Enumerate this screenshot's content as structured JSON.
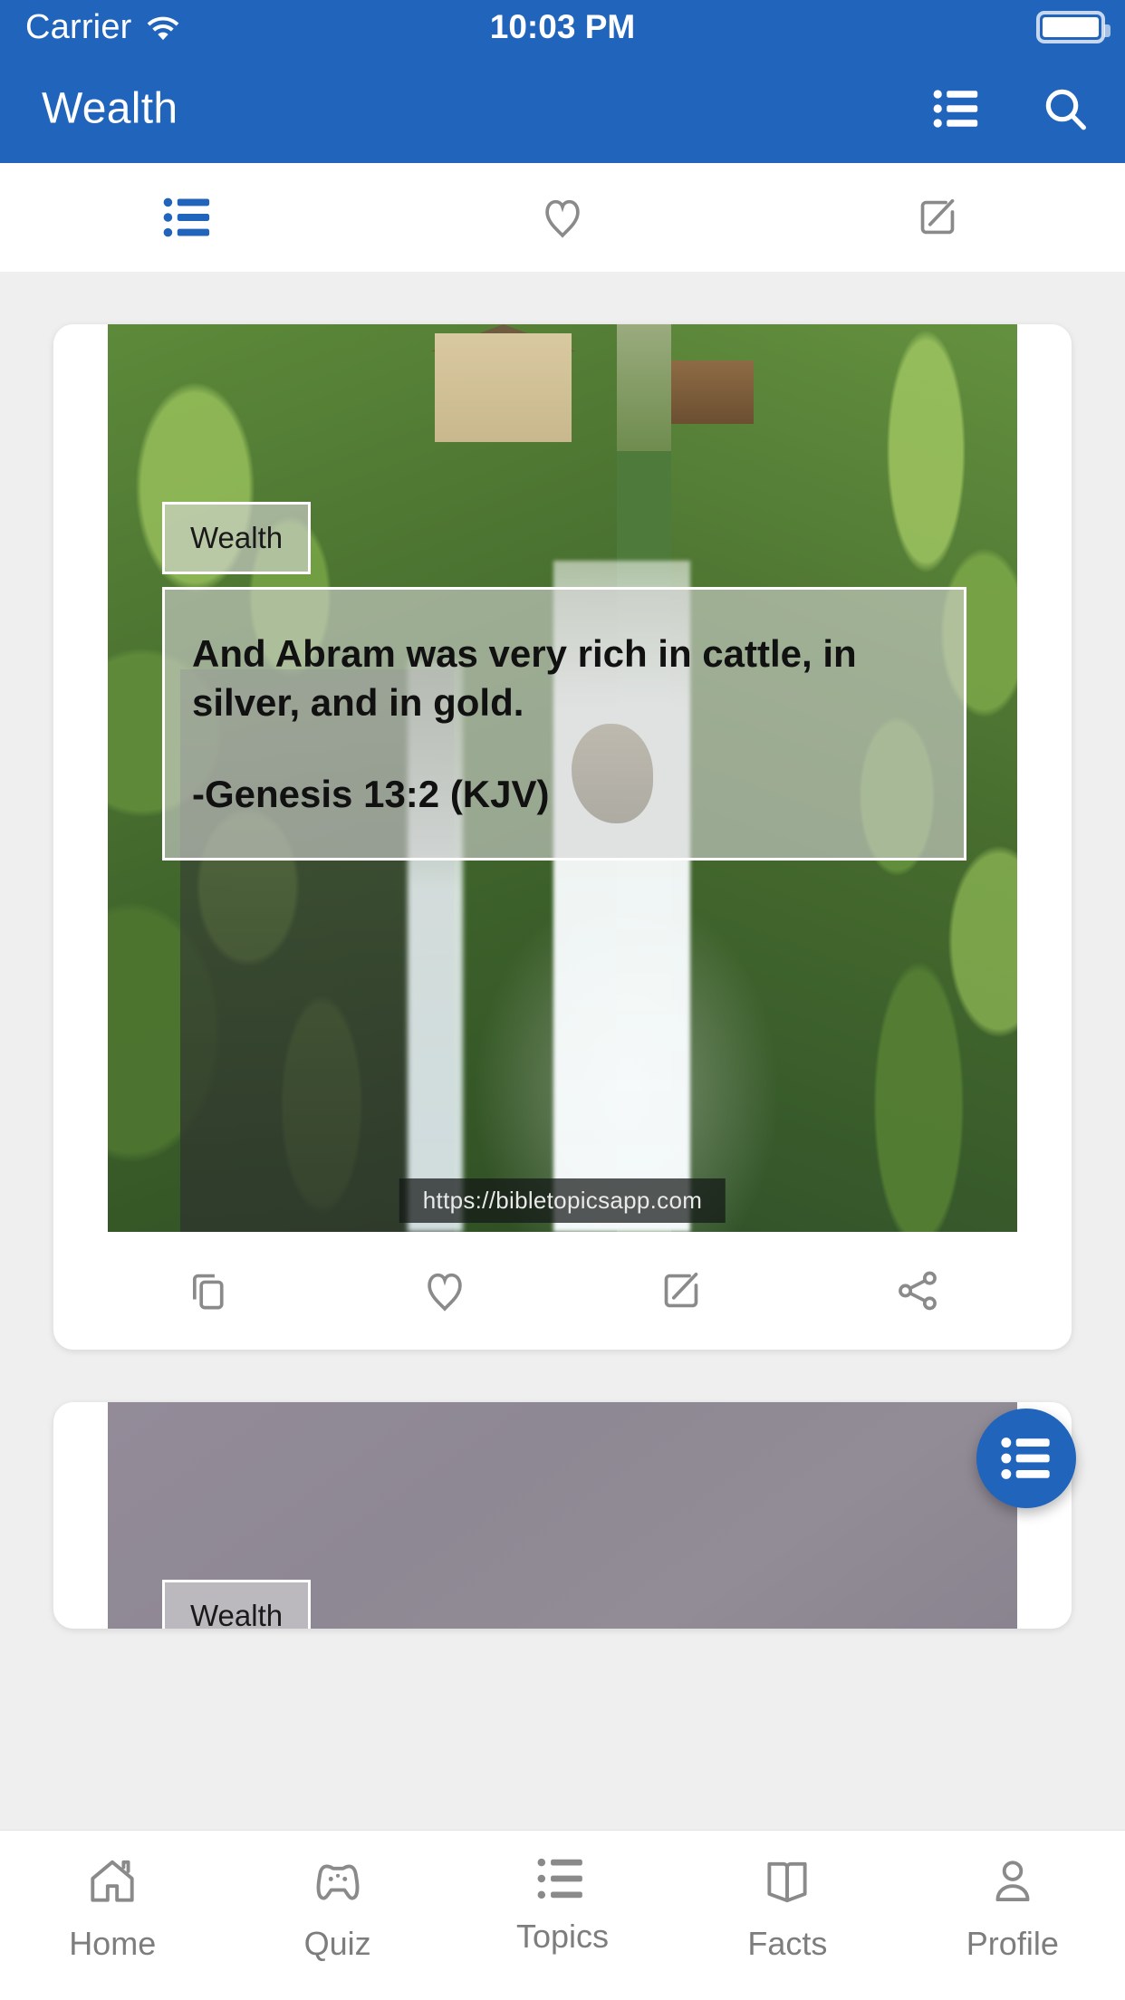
{
  "status_bar": {
    "carrier": "Carrier",
    "time": "10:03 PM",
    "wifi_icon": "wifi-icon",
    "battery_icon": "battery-full-icon"
  },
  "app_bar": {
    "title": "Wealth",
    "list_icon": "list-icon",
    "search_icon": "search-icon"
  },
  "segment_tabs": [
    {
      "name": "list",
      "icon": "list-icon",
      "active": true
    },
    {
      "name": "favorites",
      "icon": "heart-icon",
      "active": false
    },
    {
      "name": "compose",
      "icon": "edit-square-icon",
      "active": false
    }
  ],
  "cards": [
    {
      "badge": "Wealth",
      "verse": "And Abram was very rich in cattle, in silver, and in gold.",
      "reference": "-Genesis 13:2 (KJV)",
      "watermark": "https://bibletopicsapp.com",
      "actions": [
        {
          "name": "copy",
          "icon": "copy-icon"
        },
        {
          "name": "favorite",
          "icon": "heart-icon"
        },
        {
          "name": "edit",
          "icon": "edit-square-icon"
        },
        {
          "name": "share",
          "icon": "share-icon"
        }
      ]
    },
    {
      "badge": "Wealth"
    }
  ],
  "fab": {
    "name": "topics-list-fab",
    "icon": "list-icon",
    "color": "#2064bc"
  },
  "bottom_nav": [
    {
      "label": "Home",
      "icon": "home-icon"
    },
    {
      "label": "Quiz",
      "icon": "gamepad-icon"
    },
    {
      "label": "Topics",
      "icon": "list-icon"
    },
    {
      "label": "Facts",
      "icon": "open-book-icon"
    },
    {
      "label": "Profile",
      "icon": "person-icon"
    }
  ],
  "colors": {
    "accent": "#2064bc",
    "page_background": "#efefef",
    "card_background": "#ffffff",
    "inactive_icon": "#8a8a8a",
    "nav_label": "#7d7d7d"
  }
}
